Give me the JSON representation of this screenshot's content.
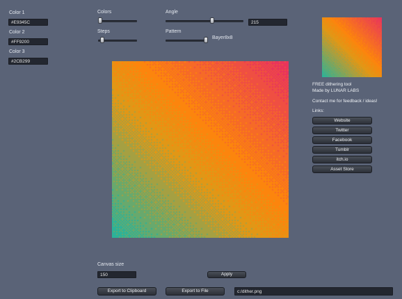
{
  "colors_panel": {
    "color1_label": "Color 1",
    "color1_value": "#E9345C",
    "color2_label": "Color 2",
    "color2_value": "#FF9200",
    "color3_label": "Color 3",
    "color3_value": "#2CB299"
  },
  "settings": {
    "colors_label": "Colors",
    "colors_level": 0.05,
    "steps_label": "Steps",
    "steps_level": 0.1,
    "angle_label": "Angle",
    "angle_level": 0.6,
    "angle_value": "215",
    "pattern_label": "Pattern",
    "pattern_level": 1.0,
    "pattern_value": "Bayer8x8"
  },
  "gradient": {
    "angle_deg": 215,
    "stops": [
      "#E9345C",
      "#FF9200",
      "#2CB299"
    ]
  },
  "info": {
    "line1": "FREE dithering tool",
    "line2": "Made by LUNAR LABS",
    "line3": "Contact me for feedback / ideas!",
    "links_label": "Links:"
  },
  "links": [
    "Website",
    "Twitter",
    "Facebook",
    "Tumblr",
    "itch.io",
    "Asset Store"
  ],
  "bottom": {
    "canvas_size_label": "Canvas size",
    "canvas_size_value": "150",
    "apply_label": "Apply",
    "export_clipboard_label": "Export to Clipboard",
    "export_file_label": "Export to File",
    "file_path": "c:/dither.png"
  }
}
